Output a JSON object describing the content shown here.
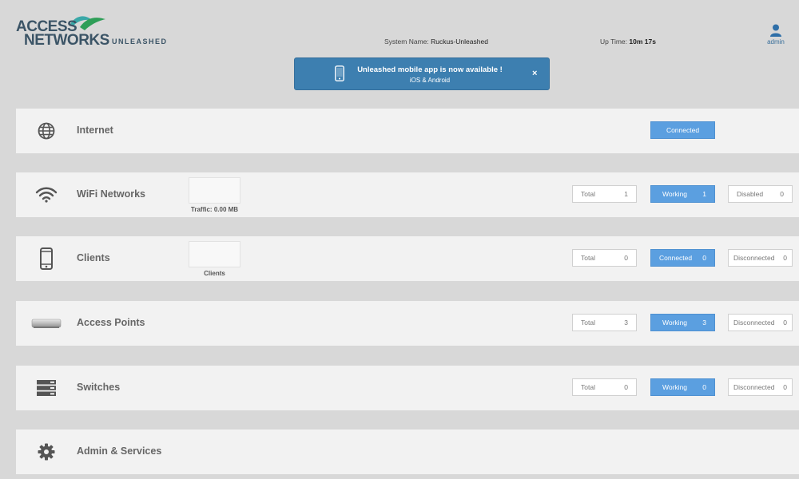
{
  "brand": {
    "line1": "ACCESS",
    "line2": "NETWORKS",
    "sub": "UNLEASHED",
    "colors": {
      "text": "#3b5466",
      "green": "#2e9e57",
      "teal": "#3aa8a8"
    }
  },
  "system": {
    "name_label": "System Name:",
    "name_value": "Ruckus-Unleashed",
    "uptime_label": "Up Time:",
    "uptime_value": "10m 17s"
  },
  "user": {
    "label": "admin",
    "icon": "user-icon"
  },
  "banner": {
    "title": "Unleashed mobile app is now available !",
    "subtitle": "iOS & Android",
    "close": "×",
    "icon": "phone-icon",
    "color": "#3d7fb0"
  },
  "cards": {
    "internet": {
      "title": "Internet",
      "icon": "globe-icon",
      "status": "Connected"
    },
    "wifi": {
      "title": "WiFi Networks",
      "icon": "wifi-icon",
      "chart_label": "Traffic: 0.00 MB",
      "stats": [
        {
          "label": "Total",
          "value": "1"
        },
        {
          "label": "Working",
          "value": "1"
        },
        {
          "label": "Disabled",
          "value": "0"
        }
      ]
    },
    "clients": {
      "title": "Clients",
      "icon": "smartphone-icon",
      "chart_label": "Clients",
      "stats": [
        {
          "label": "Total",
          "value": "0"
        },
        {
          "label": "Connected",
          "value": "0"
        },
        {
          "label": "Disconnected",
          "value": "0"
        }
      ]
    },
    "aps": {
      "title": "Access Points",
      "icon": "access-point-icon",
      "stats": [
        {
          "label": "Total",
          "value": "3"
        },
        {
          "label": "Working",
          "value": "3"
        },
        {
          "label": "Disconnected",
          "value": "0"
        }
      ]
    },
    "switches": {
      "title": "Switches",
      "icon": "switch-stack-icon",
      "stats": [
        {
          "label": "Total",
          "value": "0"
        },
        {
          "label": "Working",
          "value": "0"
        },
        {
          "label": "Disconnected",
          "value": "0"
        }
      ]
    },
    "admin": {
      "title": "Admin & Services",
      "icon": "gear-icon"
    }
  },
  "colors": {
    "accent": "#5b9fe0",
    "card_bg": "#f2f2f2",
    "page_bg": "#d8d8d8"
  }
}
